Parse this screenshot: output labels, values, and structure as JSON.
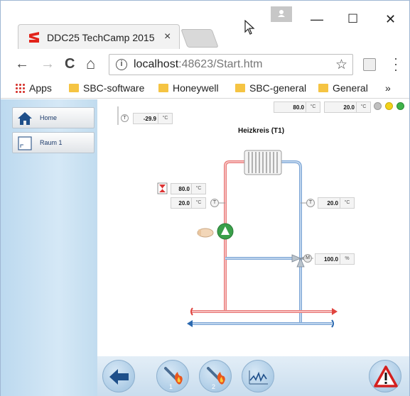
{
  "browser": {
    "tab_title": "DDC25 TechCamp 2015",
    "tab_close": "×",
    "url_host": "localhost",
    "url_rest": ":48623/Start.htm",
    "nav": {
      "back": "←",
      "forward": "→",
      "reload": "C",
      "home": "⌂"
    },
    "star": "☆",
    "window": {
      "minimize": "—",
      "maximize": "☐",
      "close": "✕"
    },
    "bookmarks": [
      "Apps",
      "SBC-software",
      "Honeywell",
      "SBC-general",
      "General"
    ],
    "bookmarks_more": "»"
  },
  "sidebar": {
    "items": [
      {
        "label": "Home",
        "icon": "home-icon"
      },
      {
        "label": "Raum 1",
        "icon": "room-icon"
      }
    ]
  },
  "plant": {
    "title": "Heizkreis (T1)",
    "outdoor": {
      "label": "T",
      "value": "-29.9",
      "unit": "°C"
    },
    "top_left": {
      "value": "80.0",
      "unit": "°C"
    },
    "top_right": {
      "value": "20.0",
      "unit": "°C"
    },
    "setpoint": {
      "value": "80.0",
      "unit": "°C"
    },
    "supply_temp": {
      "label": "T",
      "value": "20.0",
      "unit": "°C"
    },
    "return_temp": {
      "label": "T",
      "value": "20.0",
      "unit": "°C"
    },
    "valve": {
      "label": "M",
      "value": "100.0",
      "unit": "%"
    },
    "status_leds": [
      "#c0c0c0",
      "#f2d21b",
      "#3fb24a"
    ]
  },
  "bottom": {
    "buttons": [
      "back-button",
      "burner-1-button",
      "burner-2-button",
      "trend-button",
      "alarm-button"
    ],
    "burner1_label": "1",
    "burner2_label": "2"
  },
  "colors": {
    "supply": "#e87a78",
    "return": "#7fa7d6",
    "pump": "#3aa04a"
  }
}
